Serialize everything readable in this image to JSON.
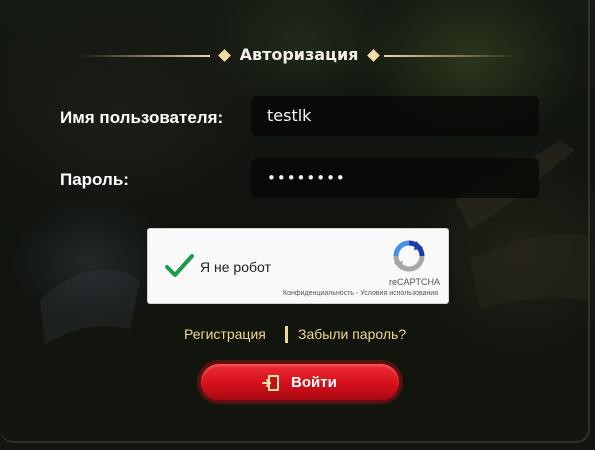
{
  "page": {
    "title": "Авторизация"
  },
  "form": {
    "username_label": "Имя пользователя:",
    "username_value": "testlk",
    "password_label": "Пароль:",
    "password_value": "••••••••"
  },
  "captcha": {
    "checked": true,
    "label": "Я не робот",
    "brand": "reCAPTCHA",
    "privacy": "Конфиденциальность",
    "separator": " - ",
    "terms": "Условия использования"
  },
  "links": {
    "register": "Регистрация",
    "forgot": "Забыли пароль?"
  },
  "login_button": {
    "label": "Войти",
    "icon": "login-door-icon"
  },
  "colors": {
    "accent_gold": "#ecd98e",
    "button_red": "#d3101b",
    "check_green": "#1a9c50"
  }
}
